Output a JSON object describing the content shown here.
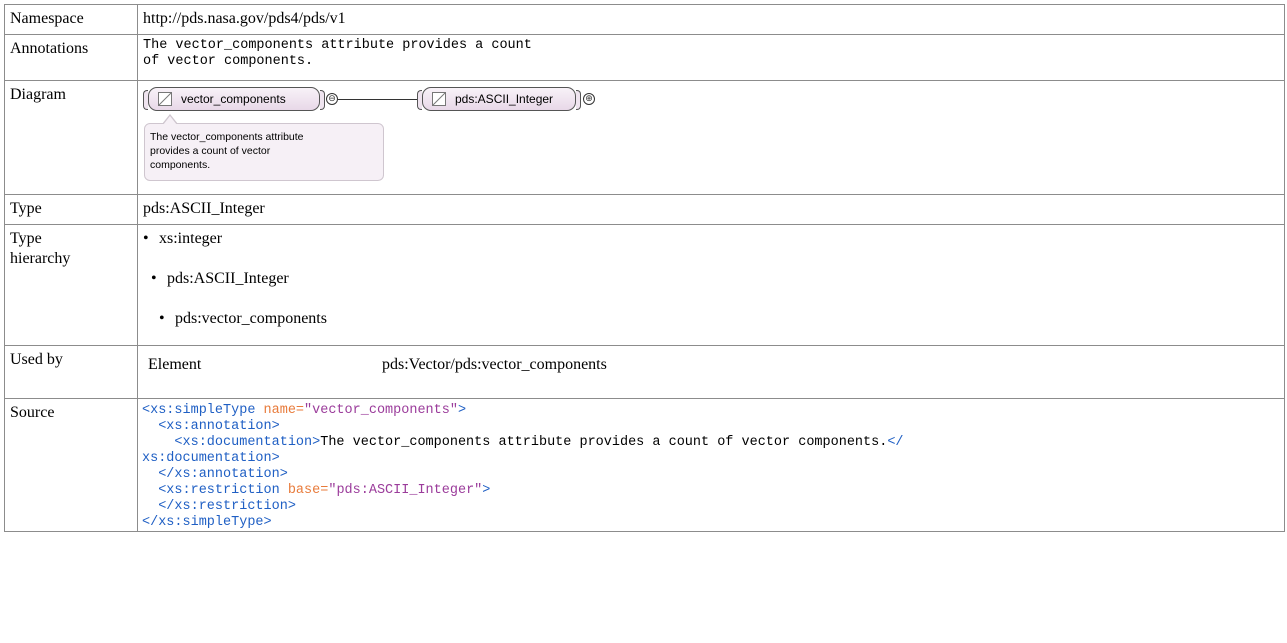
{
  "rows": {
    "namespace": {
      "label": "Namespace",
      "value": "http://pds.nasa.gov/pds4/pds/v1"
    },
    "annotations": {
      "label": "Annotations",
      "lines": [
        "The vector_components attribute provides a count",
        "of vector components."
      ]
    },
    "diagram": {
      "label": "Diagram",
      "node_main": "vector_components",
      "node_type": "pds:ASCII_Integer",
      "collapse_symbol": "⊖",
      "expand_symbol": "⊕",
      "tooltip_lines": [
        "The vector_components attribute",
        "provides a count of vector",
        "components."
      ]
    },
    "type": {
      "label": "Type",
      "value": "pds:ASCII_Integer"
    },
    "hierarchy": {
      "label_line1": "Type",
      "label_line2": "hierarchy",
      "items": [
        "xs:integer",
        "pds:ASCII_Integer",
        "pds:vector_components"
      ],
      "bullet": "•"
    },
    "used_by": {
      "label": "Used by",
      "kind": "Element",
      "path": "pds:Vector/pds:vector_components"
    },
    "source": {
      "label": "Source",
      "l1_open": "<xs:simpleType",
      "l1_attr": " name=",
      "l1_val": "\"vector_components\"",
      "l1_close": ">",
      "l2": "  <xs:annotation>",
      "l3_open": "    <xs:documentation>",
      "l3_text": "The vector_components attribute provides a count of vector components.",
      "l3_close": "</",
      "l4": "xs:documentation>",
      "l5": "  </xs:annotation>",
      "l6_open": "  <xs:restriction",
      "l6_attr": " base=",
      "l6_val": "\"pds:ASCII_Integer\"",
      "l6_close": ">",
      "l7": "  </xs:restriction>",
      "l8": "</xs:simpleType>"
    }
  },
  "colors": {
    "xml_tag": "#1f5fc4",
    "xml_attr": "#e87b3b",
    "xml_value": "#9b3c9b",
    "node_fill": "#efe4ef",
    "border": "#8c8c8c"
  }
}
